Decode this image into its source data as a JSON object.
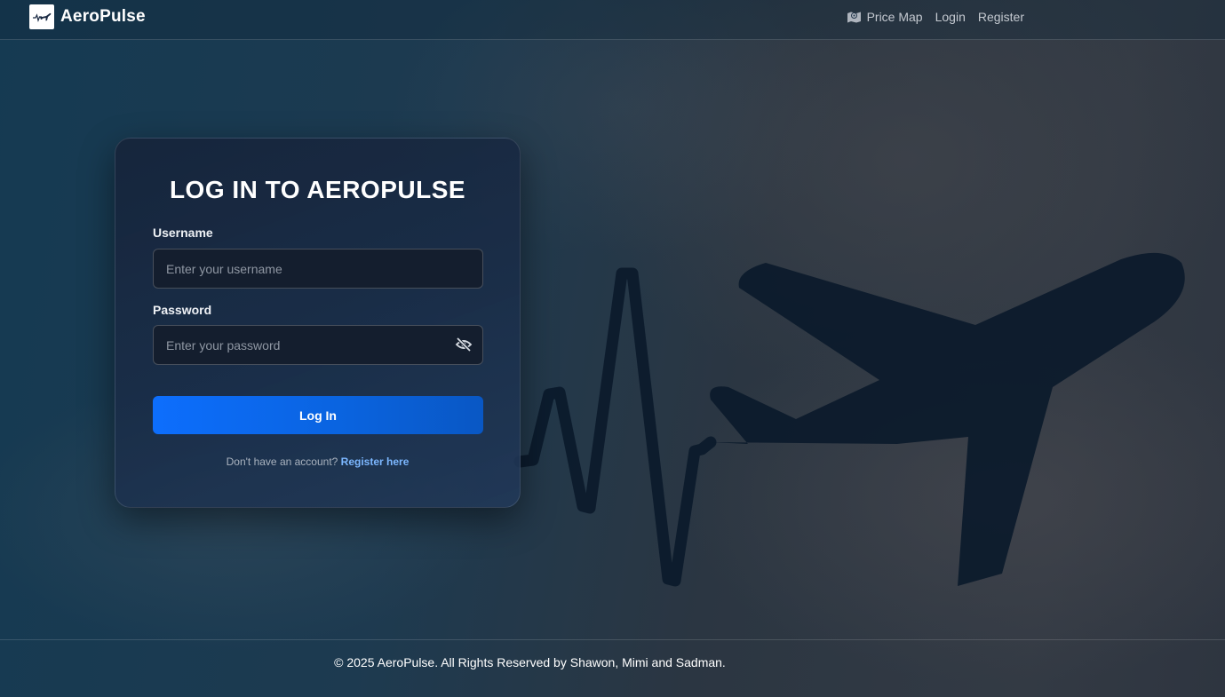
{
  "brand": {
    "name": "AeroPulse",
    "logo_icon": "plane-pulse-icon"
  },
  "nav": {
    "items": [
      {
        "label": "Price Map",
        "icon": "map-icon"
      },
      {
        "label": "Login"
      },
      {
        "label": "Register"
      }
    ]
  },
  "login": {
    "title": "LOG IN TO AEROPULSE",
    "username_label": "Username",
    "username_placeholder": "Enter your username",
    "username_value": "",
    "password_label": "Password",
    "password_placeholder": "Enter your password",
    "password_value": "",
    "password_toggle_icon": "eye-slash-icon",
    "submit_label": "Log In",
    "register_prompt": "Don't have an account?",
    "register_link": "Register here"
  },
  "footer": {
    "text": "© 2025 AeroPulse. All Rights Reserved by Shawon, Mimi and Sadman."
  },
  "colors": {
    "accent": "#0d6efd",
    "link": "#7cb7ff",
    "card_bg": "#16243a",
    "silhouette": "#0b1a2b"
  },
  "background_icon": "plane-heartbeat-silhouette"
}
